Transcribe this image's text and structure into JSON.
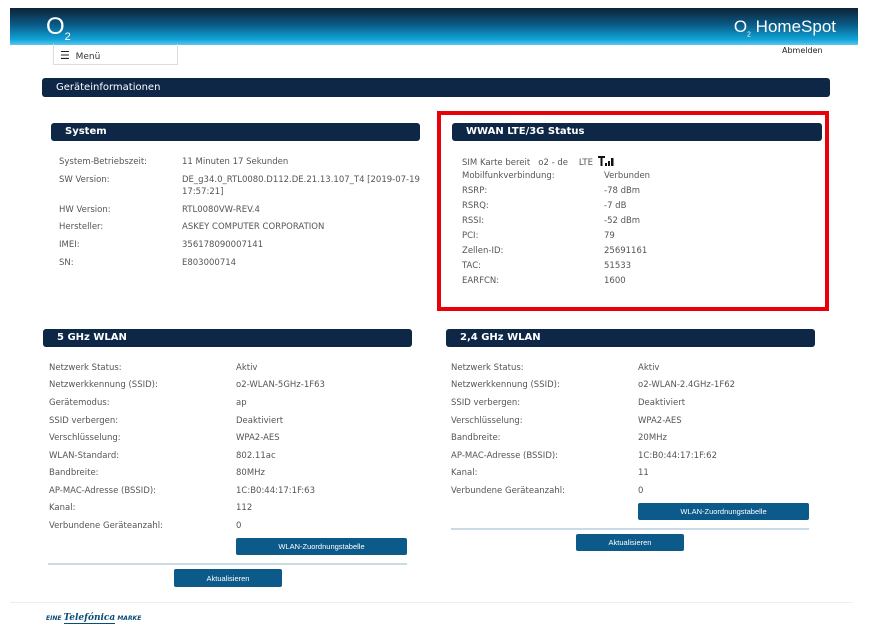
{
  "header": {
    "logo": "O",
    "logo_sub": "2",
    "brand_o": "O",
    "brand_sub": "2",
    "brand": " HomeSpot",
    "menu_label": "Menü",
    "logout": "Abmelden",
    "gradient_dark": "#0d2236",
    "gradient_light": "#10a3d8"
  },
  "page_title": "Geräteinformationen",
  "system": {
    "title": "System",
    "rows": [
      {
        "label": "System-Betriebszeit:",
        "value": "11 Minuten 17 Sekunden"
      },
      {
        "label": "SW Version:",
        "value": "DE_g34.0_RTL0080.D112.DE.21.13.107_T4 [2019-07-19",
        "value2": "17:57:21]"
      },
      {
        "label": "HW Version:",
        "value": "RTL0080VW-REV.4"
      },
      {
        "label": "Hersteller:",
        "value": "ASKEY COMPUTER CORPORATION"
      },
      {
        "label": "IMEI:",
        "value": "356178090007141"
      },
      {
        "label": "SN:",
        "value": "E803000714"
      }
    ]
  },
  "wwan": {
    "title": "WWAN LTE/3G Status",
    "sim": "SIM Karte bereit",
    "operator": "o2 - de",
    "tech": "LTE",
    "signal_icon": "signal-bars-icon",
    "highlight_color": "#e8000b",
    "rows": [
      {
        "label": "Mobilfunkverbindung:",
        "value": "Verbunden"
      },
      {
        "label": "RSRP:",
        "value": "-78 dBm"
      },
      {
        "label": "RSRQ:",
        "value": "-7 dB"
      },
      {
        "label": "RSSI:",
        "value": "-52 dBm"
      },
      {
        "label": "PCI:",
        "value": "79"
      },
      {
        "label": "Zellen-ID:",
        "value": "25691161"
      },
      {
        "label": "TAC:",
        "value": "51533"
      },
      {
        "label": "EARFCN:",
        "value": "1600"
      }
    ]
  },
  "wlan5": {
    "title": "5 GHz WLAN",
    "table_button": "WLAN-Zuordnungstabelle",
    "refresh_button": "Aktualisieren",
    "rows": [
      {
        "label": "Netzwerk Status:",
        "value": "Aktiv"
      },
      {
        "label": "Netzwerkkennung (SSID):",
        "value": "o2-WLAN-5GHz-1F63"
      },
      {
        "label": "Gerätemodus:",
        "value": "ap"
      },
      {
        "label": "SSID verbergen:",
        "value": "Deaktiviert"
      },
      {
        "label": "Verschlüsselung:",
        "value": "WPA2-AES"
      },
      {
        "label": "WLAN-Standard:",
        "value": "802.11ac"
      },
      {
        "label": "Bandbreite:",
        "value": "80MHz"
      },
      {
        "label": "AP-MAC-Adresse (BSSID):",
        "value": "1C:B0:44:17:1F:63"
      },
      {
        "label": "Kanal:",
        "value": "112"
      },
      {
        "label": "Verbundene Geräteanzahl:",
        "value": "0"
      }
    ]
  },
  "wlan24": {
    "title": "2,4 GHz WLAN",
    "table_button": "WLAN-Zuordnungstabelle",
    "refresh_button": "Aktualisieren",
    "rows": [
      {
        "label": "Netzwerk Status:",
        "value": "Aktiv"
      },
      {
        "label": "Netzwerkkennung (SSID):",
        "value": "o2-WLAN-2.4GHz-1F62"
      },
      {
        "label": "SSID verbergen:",
        "value": "Deaktiviert"
      },
      {
        "label": "Verschlüsselung:",
        "value": "WPA2-AES"
      },
      {
        "label": "Bandbreite:",
        "value": "20MHz"
      },
      {
        "label": "AP-MAC-Adresse (BSSID):",
        "value": "1C:B0:44:17:1F:62"
      },
      {
        "label": "Kanal:",
        "value": "11"
      },
      {
        "label": "Verbundene Geräteanzahl:",
        "value": "0"
      }
    ]
  },
  "footer": {
    "logo_text": "EINE Telefónica MARKE"
  }
}
